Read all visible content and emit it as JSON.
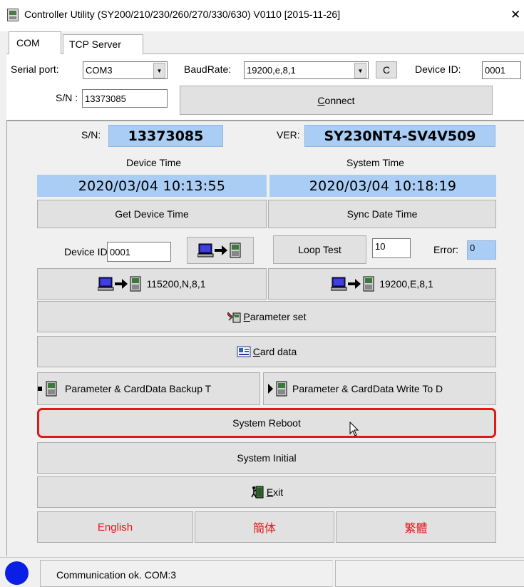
{
  "window": {
    "title": "Controller Utility (SY200/210/230/260/270/330/630) V0110 [2015-11-26]",
    "close_glyph": "✕"
  },
  "tabs": [
    {
      "label": "COM",
      "active": true
    },
    {
      "label": "TCP Server",
      "active": false
    }
  ],
  "connection": {
    "serial_port_label": "Serial port:",
    "serial_port_value": "COM3",
    "baudrate_label": "BaudRate:",
    "baudrate_value": "19200,e,8,1",
    "c_button": "C",
    "device_id_label": "Device ID:",
    "device_id_value": "0001",
    "sn_label": "S/N :",
    "sn_value": "13373085",
    "connect_label_u": "C",
    "connect_label_rest": "onnect"
  },
  "info": {
    "sn_label": "S/N:",
    "sn_value": "13373085",
    "ver_label": "VER:",
    "ver_value": "SY230NT4-SV4V509",
    "device_time_label": "Device Time",
    "device_time_value": "2020/03/04   10:13:55",
    "system_time_label": "System Time",
    "system_time_value": "2020/03/04   10:18:19"
  },
  "buttons": {
    "get_device_time": "Get Device Time",
    "sync_date_time": "Sync Date Time",
    "device_id_label": "Device ID:",
    "device_id_value": "0001",
    "loop_test": "Loop Test",
    "loop_count": "10",
    "error_label": "Error:",
    "error_value": "0",
    "baud_115200": "115200,N,8,1",
    "baud_19200": "19200,E,8,1",
    "parameter_set_u": "P",
    "parameter_set_rest": "arameter set",
    "card_data_u": "C",
    "card_data_rest": "ard data",
    "backup": "Parameter & CardData Backup T",
    "write": "Parameter & CardData Write To D",
    "system_reboot": "System Reboot",
    "system_initial": "System Initial",
    "exit_u": "E",
    "exit_rest": "xit",
    "lang_english": "English",
    "lang_simplified": "簡体",
    "lang_traditional": "繁體"
  },
  "status": {
    "text": "Communication ok.  COM:3",
    "indicator_color": "#0a1ee6"
  },
  "colors": {
    "highlight_border": "#e01818",
    "language_text": "#e01818",
    "value_box": "#a9cdf4"
  },
  "icons": {
    "app": "app-icon",
    "computer_to_controller": "pc-to-device-icon",
    "parameter": "parameter-tools-icon",
    "card": "card-data-icon",
    "exit": "exit-door-icon",
    "mouse_cursor": "mouse-cursor-icon"
  }
}
